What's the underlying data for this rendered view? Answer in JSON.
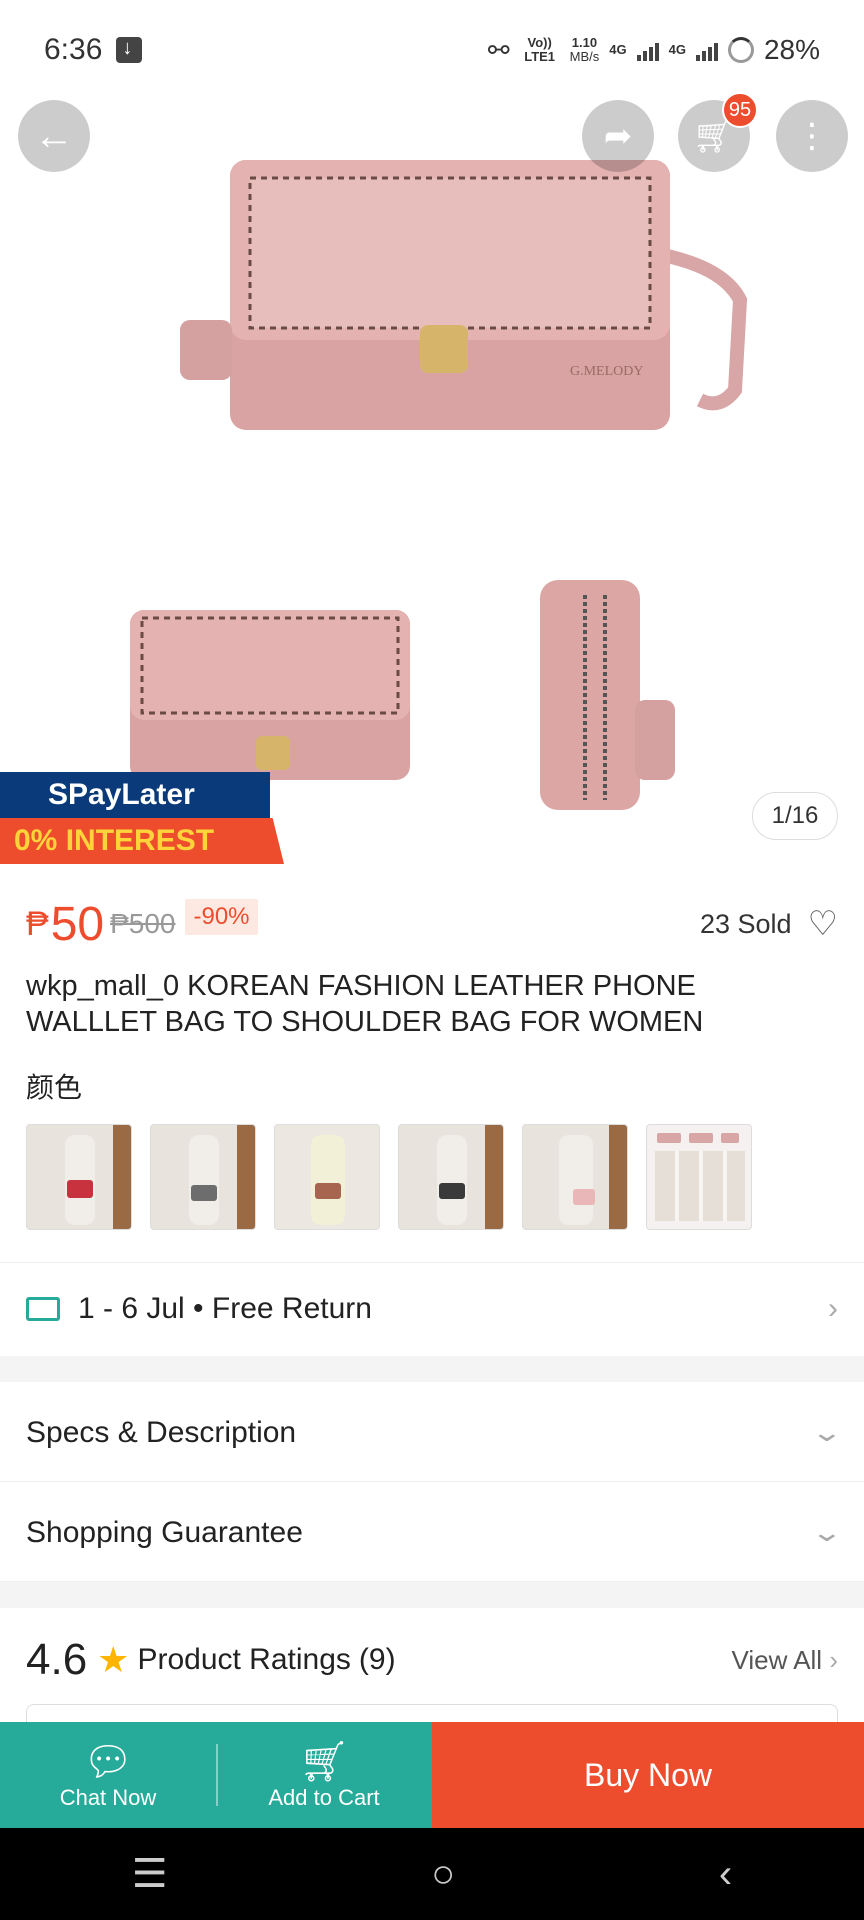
{
  "status_bar": {
    "time": "6:36",
    "volte": "Vo)) LTE1",
    "speed_value": "1.10",
    "speed_unit": "MB/s",
    "net1": "4G",
    "net2": "4G",
    "battery": "28%"
  },
  "header": {
    "back_icon": "back-arrow-icon",
    "share_icon": "share-icon",
    "cart_icon": "cart-icon",
    "cart_badge": "95",
    "more_icon": "more-vertical-icon"
  },
  "gallery": {
    "counter": "1/16",
    "brand_mark": "G.MELODY",
    "promo_top": "SPayLater",
    "promo_bottom": "0% INTEREST"
  },
  "product": {
    "currency": "₱",
    "price": "50",
    "original_price": "₱500",
    "discount": "-90%",
    "sold": "23 Sold",
    "title": "wkp_mall_0 KOREAN FASHION LEATHER PHONE WALLLET BAG TO SHOULDER BAG FOR WOMEN",
    "variation_label": "颜色",
    "variation_colors": [
      "#c8323f",
      "#6d6d6d",
      "#a7654f",
      "#3a3a3a",
      "#e9b7b7",
      "#d9a6a6"
    ]
  },
  "shipping": {
    "text": "1 - 6 Jul • Free Return"
  },
  "sections": {
    "specs": "Specs & Description",
    "guarantee": "Shopping Guarantee"
  },
  "ratings": {
    "score": "4.6",
    "label": "Product Ratings",
    "count": "(9)",
    "view_all": "View All"
  },
  "actions": {
    "chat": "Chat Now",
    "add_to_cart": "Add to Cart",
    "buy_now": "Buy Now"
  }
}
